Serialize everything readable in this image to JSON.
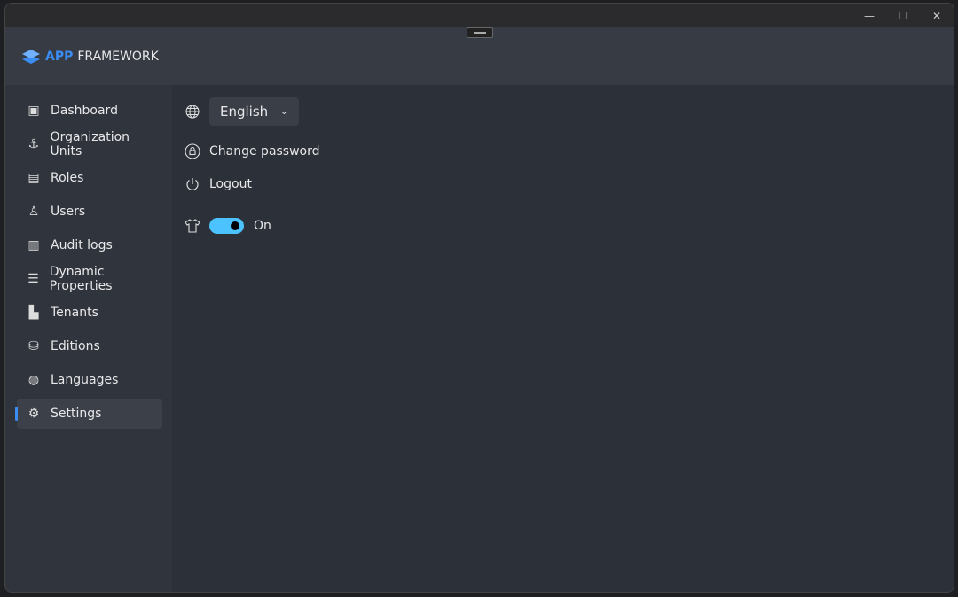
{
  "app": {
    "brand_a": "APP",
    "brand_b": "FRAMEWORK",
    "accent": "#3b8cf3"
  },
  "window_controls": {
    "minimize": "—",
    "maximize": "☐",
    "close": "✕"
  },
  "sidebar": {
    "items": [
      {
        "label": "Dashboard",
        "icon": "dashboard-icon"
      },
      {
        "label": "Organization Units",
        "icon": "anchor-icon"
      },
      {
        "label": "Roles",
        "icon": "id-card-icon"
      },
      {
        "label": "Users",
        "icon": "users-icon"
      },
      {
        "label": "Audit logs",
        "icon": "clipboard-icon"
      },
      {
        "label": "Dynamic Properties",
        "icon": "table-icon"
      },
      {
        "label": "Tenants",
        "icon": "building-icon"
      },
      {
        "label": "Editions",
        "icon": "database-icon"
      },
      {
        "label": "Languages",
        "icon": "globe-icon"
      },
      {
        "label": "Settings",
        "icon": "gear-icon",
        "active": true
      }
    ]
  },
  "settings": {
    "language": "English",
    "change_password": "Change password",
    "logout": "Logout",
    "theme_toggle": {
      "label": "On",
      "on": true,
      "color": "#4cc2ff"
    }
  }
}
